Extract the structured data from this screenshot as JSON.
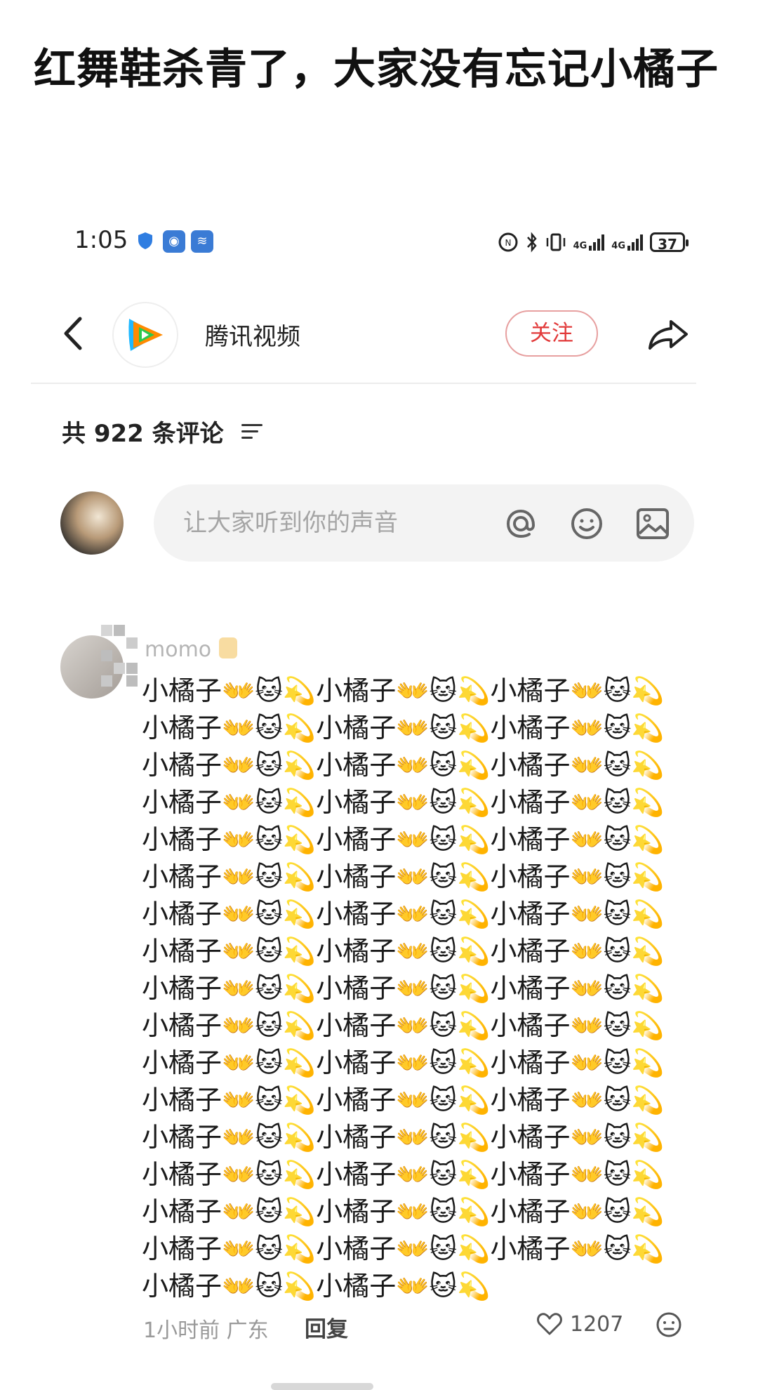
{
  "post": {
    "title": "红舞鞋杀青了，大家没有忘记小橘子"
  },
  "statusbar": {
    "time": "1:05",
    "battery": "37",
    "network_a": "4G",
    "network_b": "4G"
  },
  "header": {
    "channel_name": "腾讯视频",
    "follow_label": "关注"
  },
  "comments_header": {
    "count_label": "共 922 条评论"
  },
  "input": {
    "placeholder": "让大家听到你的声音"
  },
  "comment": {
    "username": "momo",
    "line_unit": "小橘子👐🐱💫",
    "full_lines": 16,
    "lines": [
      "小橘子👐🐱💫小橘子👐🐱💫小橘子👐🐱💫",
      "小橘子👐🐱💫小橘子👐🐱💫小橘子👐🐱💫",
      "小橘子👐🐱💫小橘子👐🐱💫小橘子👐🐱💫",
      "小橘子👐🐱💫小橘子👐🐱💫小橘子👐🐱💫",
      "小橘子👐🐱💫小橘子👐🐱💫小橘子👐🐱💫",
      "小橘子👐🐱💫小橘子👐🐱💫小橘子👐🐱💫",
      "小橘子👐🐱💫小橘子👐🐱💫小橘子👐🐱💫",
      "小橘子👐🐱💫小橘子👐🐱💫小橘子👐🐱💫",
      "小橘子👐🐱💫小橘子👐🐱💫小橘子👐🐱💫",
      "小橘子👐🐱💫小橘子👐🐱💫小橘子👐🐱💫",
      "小橘子👐🐱💫小橘子👐🐱💫小橘子👐🐱💫",
      "小橘子👐🐱💫小橘子👐🐱💫小橘子👐🐱💫",
      "小橘子👐🐱💫小橘子👐🐱💫小橘子👐🐱💫",
      "小橘子👐🐱💫小橘子👐🐱💫小橘子👐🐱💫",
      "小橘子👐🐱💫小橘子👐🐱💫小橘子👐🐱💫",
      "小橘子👐🐱💫小橘子👐🐱💫小橘子👐🐱💫",
      "小橘子👐🐱💫小橘子👐🐱💫"
    ],
    "time_location": "1小时前 广东",
    "reply_label": "回复",
    "like_count": "1207"
  },
  "colors": {
    "follow_red": "#e23a3a",
    "input_bg": "#f3f3f3",
    "meta_gray": "#999999"
  },
  "icons": [
    "back-icon",
    "tencent-video-logo",
    "share-icon",
    "sort-icon",
    "at-icon",
    "emoji-icon",
    "image-icon",
    "heart-icon",
    "face-icon"
  ]
}
